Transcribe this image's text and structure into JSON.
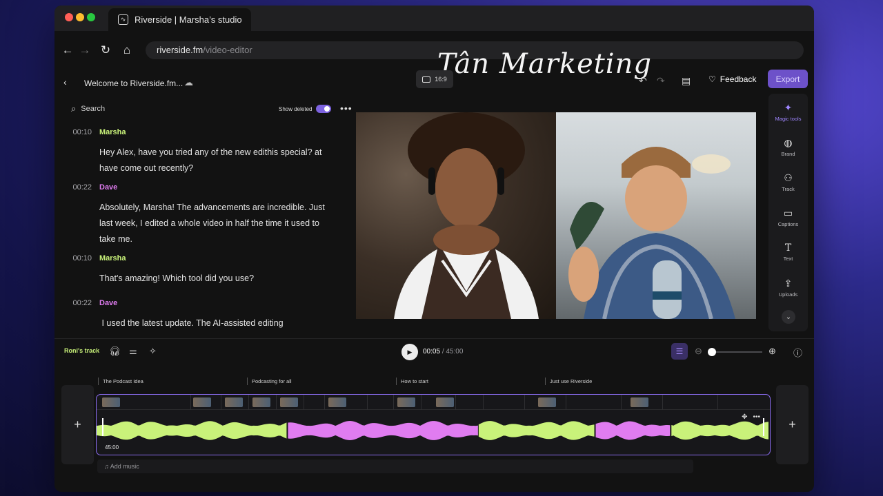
{
  "browser": {
    "tab_title": "Riverside | Marsha’s studio",
    "url_domain": "riverside.fm",
    "url_path": "/video-editor",
    "watermark": "Tân Marketing"
  },
  "header": {
    "project_title": "Welcome to Riverside.fm...",
    "aspect_ratio": "16:9",
    "feedback_label": "Feedback",
    "export_label": "Export"
  },
  "transcript": {
    "search_placeholder": "Search",
    "show_deleted_label": "Show deleted",
    "entries": [
      {
        "time": "00:10",
        "speaker": "Marsha",
        "color": "#c9f27a",
        "text": "Hey Alex, have you tried any of the new edithis special? at have come out recently?"
      },
      {
        "time": "00:22",
        "speaker": "Dave",
        "color": "#e07cf0",
        "text": "Absolutely, Marsha! The advancements are incredible. Just last week, I edited a whole video in half the time it used to take me."
      },
      {
        "time": "00:10",
        "speaker": "Marsha",
        "color": "#c9f27a",
        "text": "That's amazing! Which tool did you use?"
      },
      {
        "time": "00:22",
        "speaker": "Dave",
        "color": "#e07cf0",
        "text": " I used the latest update. The AI-assisted editing"
      }
    ]
  },
  "tools": {
    "items": [
      {
        "label": "Magic tools",
        "icon": "sparkle-icon"
      },
      {
        "label": "Brand",
        "icon": "palette-icon"
      },
      {
        "label": "Track",
        "icon": "people-icon"
      },
      {
        "label": "Captions",
        "icon": "captions-icon"
      },
      {
        "label": "Text",
        "icon": "text-icon"
      },
      {
        "label": "Uploads",
        "icon": "upload-icon"
      }
    ]
  },
  "controls": {
    "track_name": "Roni's track",
    "current_time": "00:05",
    "total_time": "45:00"
  },
  "timeline": {
    "chapters": [
      "The Podcast Idea",
      "Podcasting for all",
      "How to start",
      "Just use Riverside"
    ],
    "track_time": "45:00",
    "add_music_label": "Add music"
  },
  "colors": {
    "accent": "#6d51c9",
    "marsha": "#c9f27a",
    "dave": "#e07cf0"
  }
}
